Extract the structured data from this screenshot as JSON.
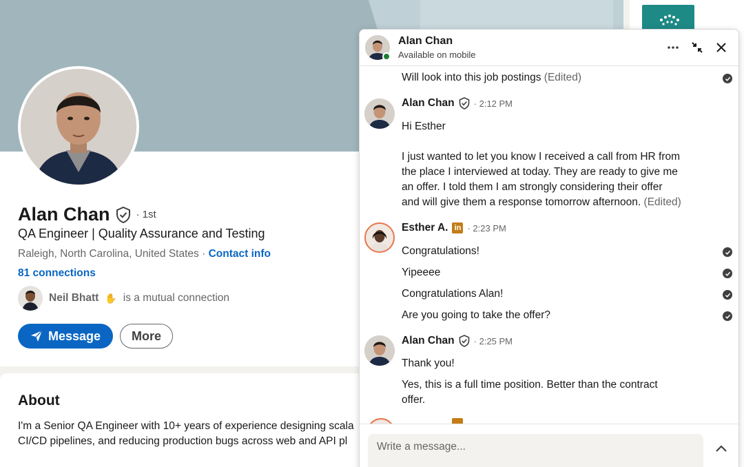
{
  "profile": {
    "name": "Alan Chan",
    "degree": "· 1st",
    "headline": "QA Engineer | Quality Assurance and Testing",
    "location": "Raleigh, North Carolina, United States ·",
    "contact_info": "Contact info",
    "connections": "81 connections",
    "mutual_name": "Neil Bhatt",
    "mutual_suffix": "is a mutual connection",
    "message_button": "Message",
    "more_button": "More"
  },
  "about": {
    "title": "About",
    "line1": "I'm a Senior QA Engineer with 10+ years of experience designing scala",
    "line2": "CI/CD pipelines, and reducing production bugs across web and API pl"
  },
  "chat": {
    "name": "Alan Chan",
    "status": "Available on mobile",
    "messages": {
      "top_text": "Will look into this job postings",
      "top_edited": "(Edited)",
      "g1_sender": "Alan Chan",
      "g1_time": "· 2:12 PM",
      "g1_l1": "Hi Esther",
      "g1_l2": "I just wanted to let you know I received a call from HR from",
      "g1_l3": "the place I interviewed at today. They are ready to give me",
      "g1_l4": "an offer. I told them I am strongly considering their offer",
      "g1_l5": "and will give them a response tomorrow afternoon.",
      "g1_edited": "(Edited)",
      "g2_sender": "Esther A.",
      "g2_badge": "in",
      "g2_time": "· 2:23 PM",
      "g2_l1": "Congratulations!",
      "g2_l2": "Yipeeee",
      "g2_l3": "Congratulations Alan!",
      "g2_l4": "Are you going to take the offer?",
      "g3_sender": "Alan Chan",
      "g3_time": "· 2:25 PM",
      "g3_l1": "Thank you!",
      "g3_l2": "Yes, this is a full time position. Better than the contract",
      "g3_l3": "offer."
    },
    "composer_placeholder": "Write a message..."
  },
  "colors": {
    "accent": "#0a66c2",
    "banner": "#a0b6bc",
    "online": "#1e7d35",
    "premium_badge": "#c37d16"
  },
  "icons": {
    "verified": "shield-check-icon",
    "send": "paper-plane-icon",
    "more": "ellipsis-icon",
    "minimize": "compress-arrows-icon",
    "close": "close-icon",
    "scroll_down": "arrow-down-icon",
    "expand": "chevron-up-icon",
    "read": "checkmark-circle-icon"
  }
}
